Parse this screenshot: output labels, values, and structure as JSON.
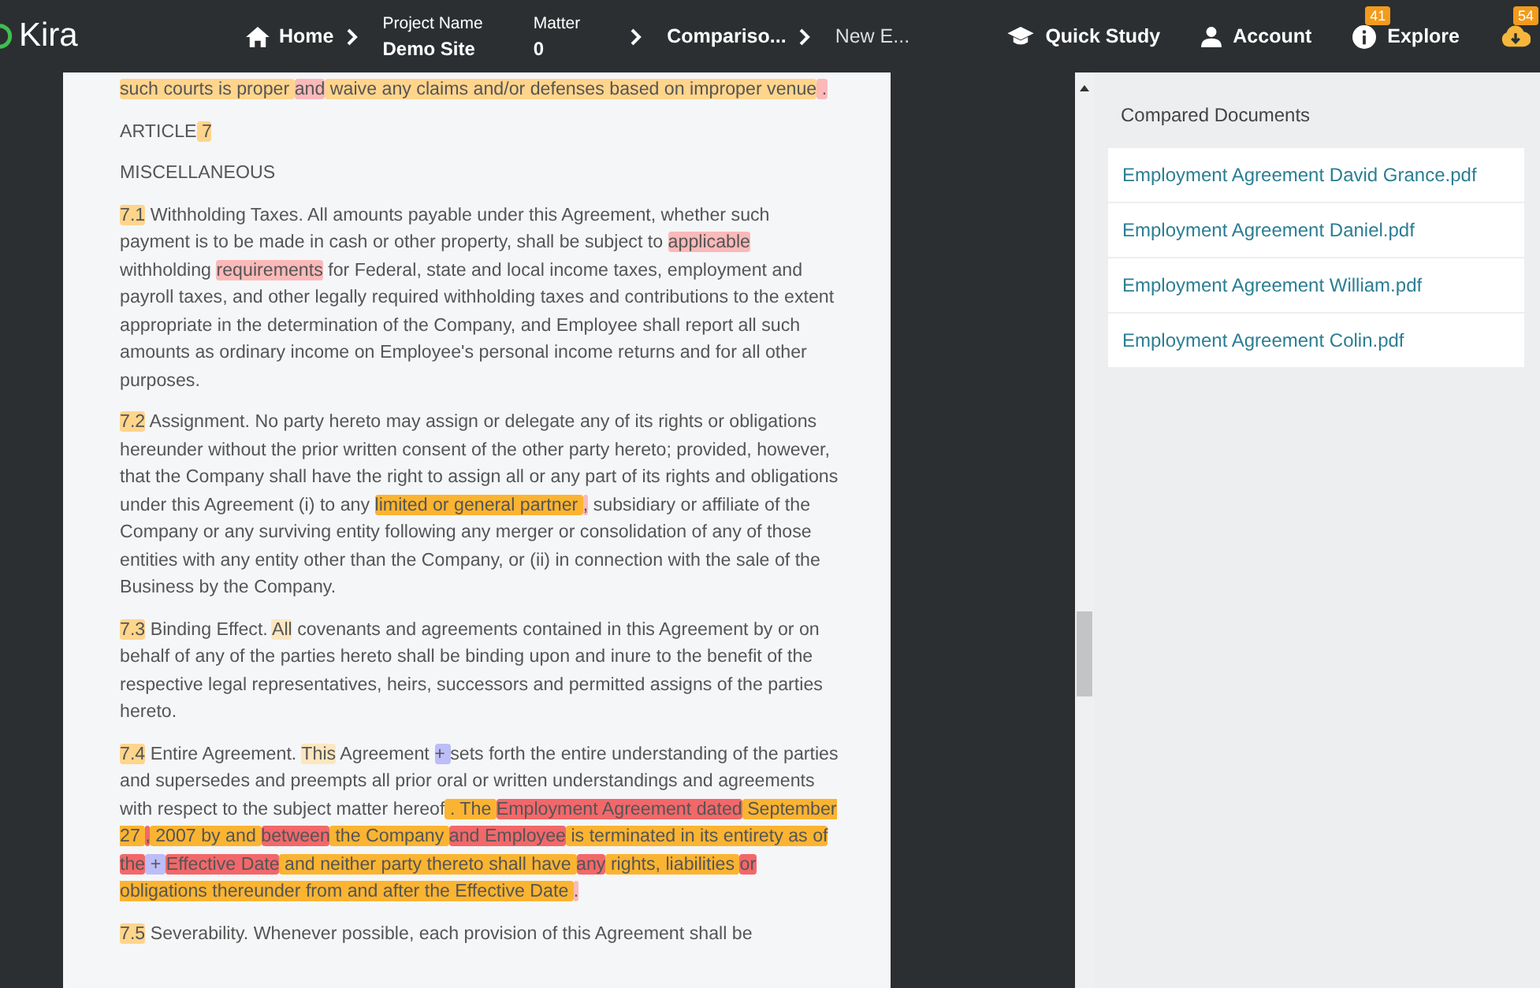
{
  "header": {
    "logo": "Kira",
    "nav": [
      {
        "kind": "link",
        "label": "Home"
      },
      {
        "kind": "field",
        "caption": "Project Name",
        "value": "Demo Site"
      },
      {
        "kind": "field",
        "caption": "Matter",
        "value": "0"
      },
      {
        "kind": "crumb",
        "label": "Compariso..."
      },
      {
        "kind": "crumb",
        "label": "New E..."
      }
    ],
    "actions": [
      {
        "label": "Quick Study"
      },
      {
        "label": "Account"
      },
      {
        "label": "Explore",
        "badge": "41"
      },
      {
        "badge": "54"
      }
    ]
  },
  "document": {
    "paragraphs": [
      {
        "segments": [
          {
            "text": "such courts is proper ",
            "color": "#ffd58c"
          },
          {
            "text": "and",
            "color": "#fbb9b9"
          },
          {
            "text": " waive any claims and/or defenses based on improper venue",
            "color": "#ffd58c"
          },
          {
            "text": " . ",
            "color": "#fbb9b9"
          }
        ]
      },
      {
        "segments": [
          {
            "text": "ARTICLE"
          },
          {
            "text": " 7",
            "color": "#ffd58c"
          }
        ]
      },
      {
        "segments": [
          {
            "text": "MISCELLANEOUS"
          }
        ]
      },
      {
        "segments": [
          {
            "text": "7.1",
            "color": "#ffd58c"
          },
          {
            "text": " Withholding Taxes. All amounts payable under this Agreement, whether such payment is to be made in cash or other property, shall be subject to "
          },
          {
            "text": "applicable",
            "color": "#fbb9b9"
          },
          {
            "text": " withholding "
          },
          {
            "text": "requirements",
            "color": "#fbb9b9"
          },
          {
            "text": " for Federal, state and local income taxes, employment and payroll taxes, and other legally required withholding taxes and contributions to the extent appropriate in the determination of the Company, and Employee shall report all such amounts as ordinary income on Employee's personal income returns and for all other purposes."
          }
        ]
      },
      {
        "segments": [
          {
            "text": "7.2",
            "color": "#ffd58c"
          },
          {
            "text": " Assignment. No party hereto may assign or delegate any of its rights or obligations hereunder without the prior written consent of the other party hereto; provided, however, that the Company shall have the right to assign all or any part of its rights and obligations under this Agreement (i) to any "
          },
          {
            "text": "limited or general partner ",
            "color": "#fbb431"
          },
          {
            "text": ",",
            "color": "#fbb9b9"
          },
          {
            "text": " subsidiary or affiliate of the Company or any surviving entity following any merger or consolidation of any of those entities with any entity other than the Company, or (ii) in connection with the sale of the Business by the Company."
          }
        ]
      },
      {
        "segments": [
          {
            "text": "7.3",
            "color": "#ffd58c"
          },
          {
            "text": " Binding Effect. "
          },
          {
            "text": "All",
            "color": "#fde6bf"
          },
          {
            "text": " covenants and agreements contained in this Agreement by or on behalf of any of the parties hereto shall be binding upon and inure to the benefit of the respective legal representatives, heirs, successors and permitted assigns of the parties hereto."
          }
        ]
      },
      {
        "segments": [
          {
            "text": "7.4",
            "color": "#ffd58c"
          },
          {
            "text": " Entire Agreement. "
          },
          {
            "text": "This",
            "color": "#fde6bf"
          },
          {
            "text": " Agreement "
          },
          {
            "text": " + ",
            "color": "#bdbdf8"
          },
          {
            "text": " sets forth the entire understanding of the parties and supersedes and preempts all prior oral or written understandings and agreements with respect to the subject matter hereof"
          },
          {
            "text": " . The ",
            "color": "#fbb431"
          },
          {
            "text": "Employment Agreement dated",
            "color": "#f2686a"
          },
          {
            "text": " September 27 ",
            "color": "#fbb431"
          },
          {
            "text": ",",
            "color": "#f2686a"
          },
          {
            "text": " 2007 by and ",
            "color": "#fbb431"
          },
          {
            "text": "between",
            "color": "#f2686a"
          },
          {
            "text": " the Company ",
            "color": "#fbb431"
          },
          {
            "text": "and Employee",
            "color": "#f2686a"
          },
          {
            "text": " is terminated in its entirety as of ",
            "color": "#fbb431"
          },
          {
            "text": "the",
            "color": "#f2686a"
          },
          {
            "text": " + ",
            "color": "#bdbdf8"
          },
          {
            "text": "Effective Date",
            "color": "#f2686a"
          },
          {
            "text": " and neither party thereto shall have ",
            "color": "#fbb431"
          },
          {
            "text": "any",
            "color": "#f2686a"
          },
          {
            "text": " rights, liabilities ",
            "color": "#fbb431"
          },
          {
            "text": "or",
            "color": "#f2686a"
          },
          {
            "text": " obligations thereunder from and after the Effective Date ",
            "color": "#fbb431"
          },
          {
            "text": ".",
            "color": "#fbb9b9"
          }
        ]
      },
      {
        "segments": [
          {
            "text": "7.5",
            "color": "#ffd58c"
          },
          {
            "text": " Severability. Whenever possible, each provision of this Agreement shall be"
          }
        ]
      }
    ]
  },
  "sidebar": {
    "title": "Compared Documents",
    "items": [
      "Employment Agreement David Grance.pdf",
      "Employment Agreement Daniel.pdf",
      "Employment Agreement William.pdf",
      "Employment Agreement Colin.pdf"
    ]
  }
}
